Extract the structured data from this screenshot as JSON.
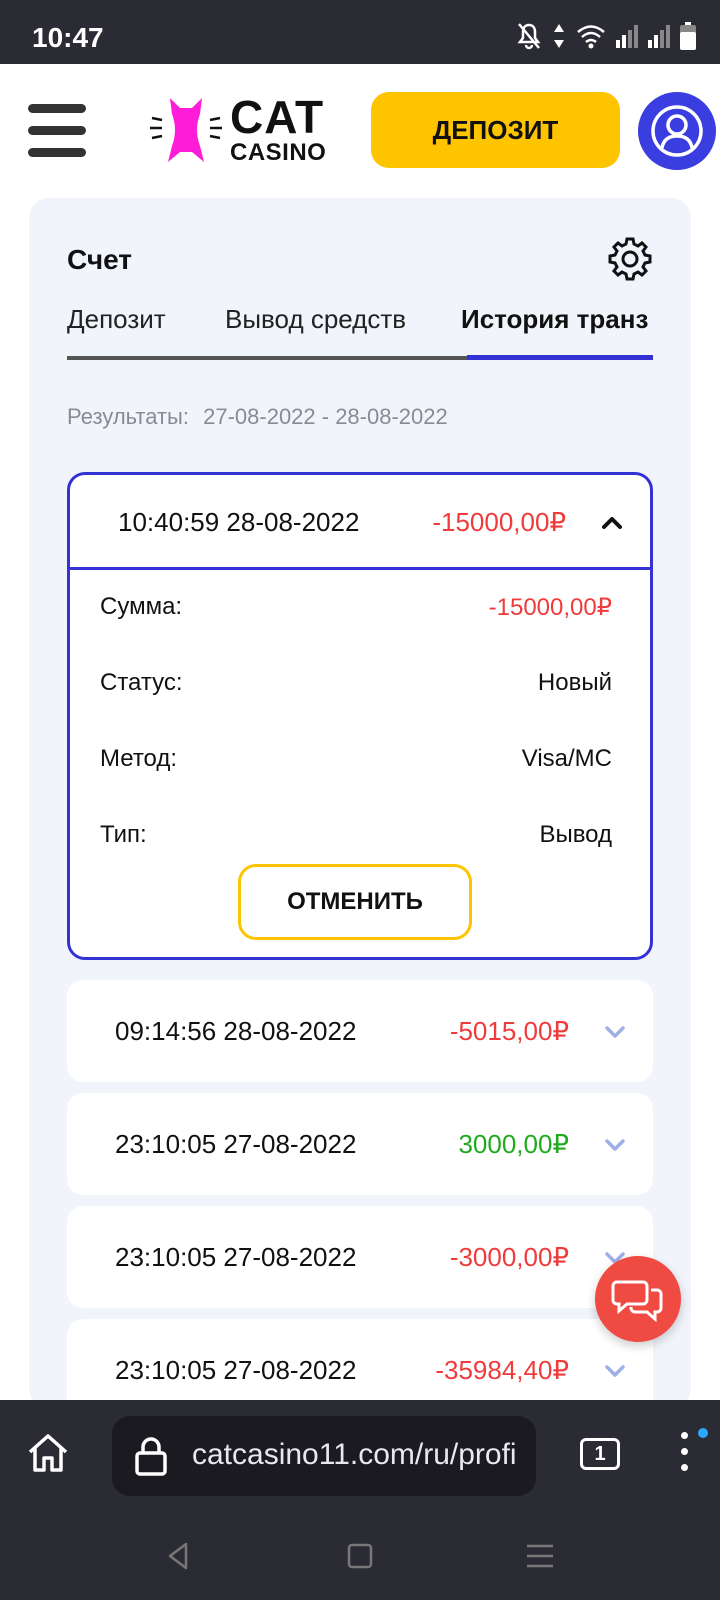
{
  "status_bar": {
    "time": "10:47"
  },
  "header": {
    "logo_cat": "CAT",
    "logo_casino": "CASINO",
    "deposit_label": "ДЕПОЗИТ"
  },
  "account": {
    "title": "Счет",
    "tabs": [
      {
        "label": "Депозит"
      },
      {
        "label": "Вывод средств"
      },
      {
        "label": "История транз"
      }
    ],
    "results_label": "Результаты:",
    "results_range": "27-08-2022 - 28-08-2022"
  },
  "expanded_tx": {
    "datetime": "10:40:59 28-08-2022",
    "amount": "-15000,00₽",
    "details": [
      {
        "key": "Сумма:",
        "value": "-15000,00₽"
      },
      {
        "key": "Статус:",
        "value": "Новый"
      },
      {
        "key": "Метод:",
        "value": "Visa/MC"
      },
      {
        "key": "Тип:",
        "value": "Вывод"
      }
    ],
    "cancel_label": "ОТМЕНИТЬ"
  },
  "transactions": [
    {
      "datetime": "09:14:56 28-08-2022",
      "amount": "-5015,00₽"
    },
    {
      "datetime": "23:10:05 27-08-2022",
      "amount": "3000,00₽"
    },
    {
      "datetime": "23:10:05 27-08-2022",
      "amount": "-3000,00₽"
    },
    {
      "datetime": "23:10:05 27-08-2022",
      "amount": "-35984,40₽"
    }
  ],
  "browser": {
    "url": "catcasino11.com/ru/profi",
    "tab_count": "1"
  },
  "colors": {
    "accent": "#3432d4",
    "yellow": "#ffc400",
    "negative": "#ef3b3b",
    "positive": "#1faa1f",
    "chat": "#ef4b43"
  }
}
